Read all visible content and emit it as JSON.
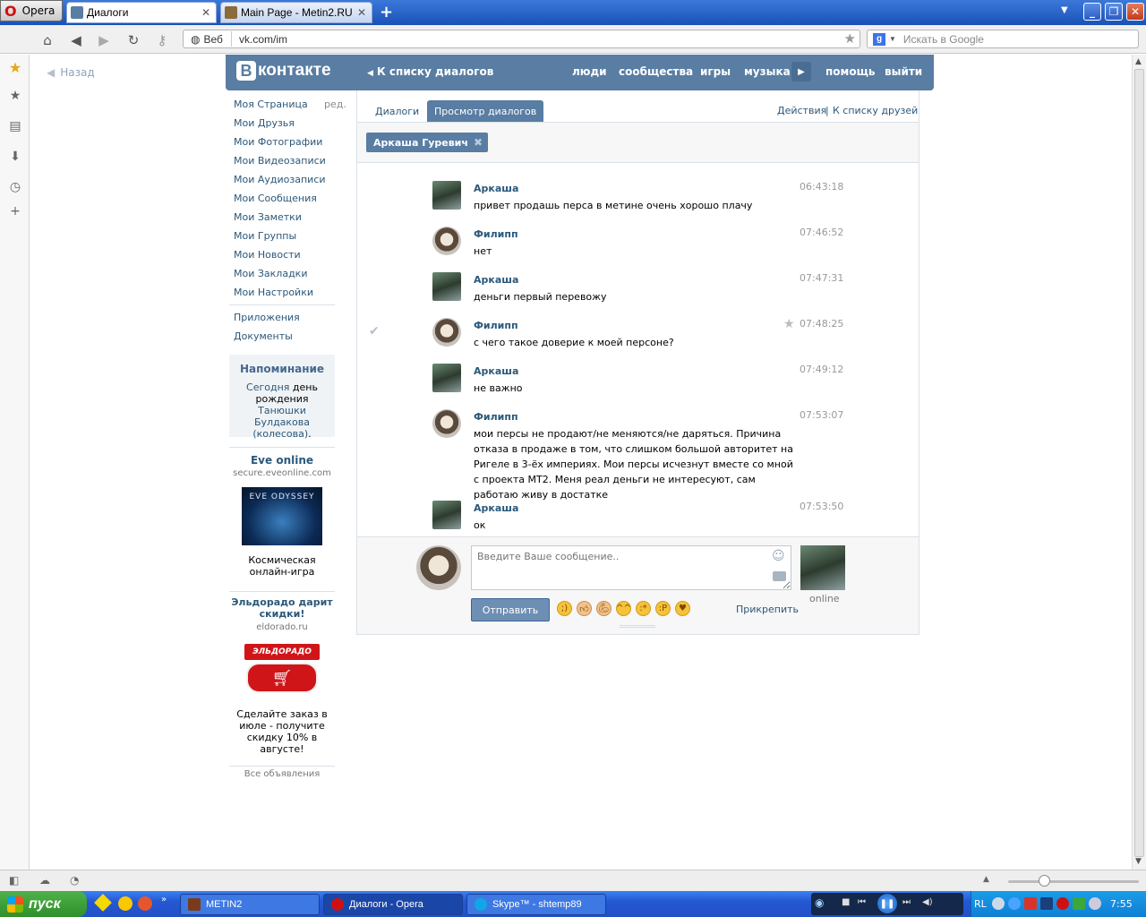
{
  "browser": {
    "menu_label": "Opera",
    "tabs": [
      {
        "title": "Диалоги"
      },
      {
        "title": "Main Page - Metin2.RU"
      }
    ],
    "address": {
      "mode": "Веб",
      "url": "vk.com/im"
    },
    "search_placeholder": "Искать в Google"
  },
  "sidebar_back": "Назад",
  "vk": {
    "logo": "контакте",
    "logo_letter": "В",
    "back_to_dialogs": "К списку диалогов",
    "nav": [
      "люди",
      "сообщества",
      "игры",
      "музыка",
      "помощь",
      "выйти"
    ],
    "menu": [
      "Моя Страница",
      "Мои Друзья",
      "Мои Фотографии",
      "Мои Видеозаписи",
      "Мои Аудиозаписи",
      "Мои Сообщения",
      "Мои Заметки",
      "Мои Группы",
      "Мои Новости",
      "Мои Закладки",
      "Мои Настройки"
    ],
    "edit_label": "ред.",
    "menu2": [
      "Приложения",
      "Документы"
    ],
    "reminder": {
      "title": "Напоминание",
      "today": "Сегодня",
      "text1": " день рождения ",
      "name": "Танюшки Булдакова (колесова)",
      "end": "."
    },
    "ads": [
      {
        "title": "Eve online",
        "url": "secure.eveonline.com",
        "text": "Космическая онлайн-игра",
        "image_caption": "EVE ODYSSEY"
      },
      {
        "title": "Эльдорадо дарит скидки!",
        "url": "eldorado.ru",
        "text": "Сделайте заказ в июле - получите скидку 10% в августе!",
        "image_caption": "ЭЛЬДОРАДО"
      }
    ],
    "all_ads": "Все объявления"
  },
  "dialog": {
    "tabs": [
      "Диалоги",
      "Просмотр диалогов"
    ],
    "actions": "Действия",
    "divider": "|",
    "friends_link": "К списку друзей",
    "peer": "Аркаша Гуревич",
    "messages": [
      {
        "author": "Аркаша",
        "time": "06:43:18",
        "text": "привет продашь перса в метине очень хорошо плачу"
      },
      {
        "author": "Филипп",
        "time": "07:46:52",
        "text": "нет"
      },
      {
        "author": "Аркаша",
        "time": "07:47:31",
        "text": "деньги первый перевожу"
      },
      {
        "author": "Филипп",
        "time": "07:48:25",
        "text": "с чего такое доверие к моей персоне?"
      },
      {
        "author": "Аркаша",
        "time": "07:49:12",
        "text": "не важно"
      },
      {
        "author": "Филипп",
        "time": "07:53:07",
        "text": "мои персы не продают/не меняются/не даряться. Причина отказа в продаже в том, что слишком большой авторитет на Ригеле в 3-ёх империях. Мои персы исчезнут вместе со мной с проекта МТ2. Меня реал деньги не интересуют, сам работаю живу в достатке"
      },
      {
        "author": "Аркаша",
        "time": "07:53:50",
        "text": "ок"
      }
    ],
    "input_placeholder": "Введите Ваше сообщение..",
    "send": "Отправить",
    "attach": "Прикрепить",
    "peer_status": "online"
  },
  "taskbar": {
    "start": "пуск",
    "tasks": [
      "METIN2",
      "Диалоги - Opera",
      "Skype™ - shtemp89"
    ],
    "lang": "RL",
    "clock": "7:55"
  },
  "colors": {
    "vk_blue": "#597da3",
    "link": "#2b587a"
  }
}
